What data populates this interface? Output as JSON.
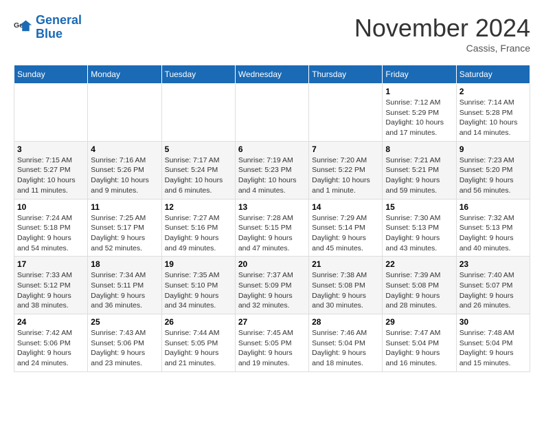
{
  "logo": {
    "text_general": "General",
    "text_blue": "Blue"
  },
  "header": {
    "month": "November 2024",
    "location": "Cassis, France"
  },
  "weekdays": [
    "Sunday",
    "Monday",
    "Tuesday",
    "Wednesday",
    "Thursday",
    "Friday",
    "Saturday"
  ],
  "weeks": [
    [
      {
        "day": "",
        "info": ""
      },
      {
        "day": "",
        "info": ""
      },
      {
        "day": "",
        "info": ""
      },
      {
        "day": "",
        "info": ""
      },
      {
        "day": "",
        "info": ""
      },
      {
        "day": "1",
        "info": "Sunrise: 7:12 AM\nSunset: 5:29 PM\nDaylight: 10 hours and 17 minutes."
      },
      {
        "day": "2",
        "info": "Sunrise: 7:14 AM\nSunset: 5:28 PM\nDaylight: 10 hours and 14 minutes."
      }
    ],
    [
      {
        "day": "3",
        "info": "Sunrise: 7:15 AM\nSunset: 5:27 PM\nDaylight: 10 hours and 11 minutes."
      },
      {
        "day": "4",
        "info": "Sunrise: 7:16 AM\nSunset: 5:26 PM\nDaylight: 10 hours and 9 minutes."
      },
      {
        "day": "5",
        "info": "Sunrise: 7:17 AM\nSunset: 5:24 PM\nDaylight: 10 hours and 6 minutes."
      },
      {
        "day": "6",
        "info": "Sunrise: 7:19 AM\nSunset: 5:23 PM\nDaylight: 10 hours and 4 minutes."
      },
      {
        "day": "7",
        "info": "Sunrise: 7:20 AM\nSunset: 5:22 PM\nDaylight: 10 hours and 1 minute."
      },
      {
        "day": "8",
        "info": "Sunrise: 7:21 AM\nSunset: 5:21 PM\nDaylight: 9 hours and 59 minutes."
      },
      {
        "day": "9",
        "info": "Sunrise: 7:23 AM\nSunset: 5:20 PM\nDaylight: 9 hours and 56 minutes."
      }
    ],
    [
      {
        "day": "10",
        "info": "Sunrise: 7:24 AM\nSunset: 5:18 PM\nDaylight: 9 hours and 54 minutes."
      },
      {
        "day": "11",
        "info": "Sunrise: 7:25 AM\nSunset: 5:17 PM\nDaylight: 9 hours and 52 minutes."
      },
      {
        "day": "12",
        "info": "Sunrise: 7:27 AM\nSunset: 5:16 PM\nDaylight: 9 hours and 49 minutes."
      },
      {
        "day": "13",
        "info": "Sunrise: 7:28 AM\nSunset: 5:15 PM\nDaylight: 9 hours and 47 minutes."
      },
      {
        "day": "14",
        "info": "Sunrise: 7:29 AM\nSunset: 5:14 PM\nDaylight: 9 hours and 45 minutes."
      },
      {
        "day": "15",
        "info": "Sunrise: 7:30 AM\nSunset: 5:13 PM\nDaylight: 9 hours and 43 minutes."
      },
      {
        "day": "16",
        "info": "Sunrise: 7:32 AM\nSunset: 5:13 PM\nDaylight: 9 hours and 40 minutes."
      }
    ],
    [
      {
        "day": "17",
        "info": "Sunrise: 7:33 AM\nSunset: 5:12 PM\nDaylight: 9 hours and 38 minutes."
      },
      {
        "day": "18",
        "info": "Sunrise: 7:34 AM\nSunset: 5:11 PM\nDaylight: 9 hours and 36 minutes."
      },
      {
        "day": "19",
        "info": "Sunrise: 7:35 AM\nSunset: 5:10 PM\nDaylight: 9 hours and 34 minutes."
      },
      {
        "day": "20",
        "info": "Sunrise: 7:37 AM\nSunset: 5:09 PM\nDaylight: 9 hours and 32 minutes."
      },
      {
        "day": "21",
        "info": "Sunrise: 7:38 AM\nSunset: 5:08 PM\nDaylight: 9 hours and 30 minutes."
      },
      {
        "day": "22",
        "info": "Sunrise: 7:39 AM\nSunset: 5:08 PM\nDaylight: 9 hours and 28 minutes."
      },
      {
        "day": "23",
        "info": "Sunrise: 7:40 AM\nSunset: 5:07 PM\nDaylight: 9 hours and 26 minutes."
      }
    ],
    [
      {
        "day": "24",
        "info": "Sunrise: 7:42 AM\nSunset: 5:06 PM\nDaylight: 9 hours and 24 minutes."
      },
      {
        "day": "25",
        "info": "Sunrise: 7:43 AM\nSunset: 5:06 PM\nDaylight: 9 hours and 23 minutes."
      },
      {
        "day": "26",
        "info": "Sunrise: 7:44 AM\nSunset: 5:05 PM\nDaylight: 9 hours and 21 minutes."
      },
      {
        "day": "27",
        "info": "Sunrise: 7:45 AM\nSunset: 5:05 PM\nDaylight: 9 hours and 19 minutes."
      },
      {
        "day": "28",
        "info": "Sunrise: 7:46 AM\nSunset: 5:04 PM\nDaylight: 9 hours and 18 minutes."
      },
      {
        "day": "29",
        "info": "Sunrise: 7:47 AM\nSunset: 5:04 PM\nDaylight: 9 hours and 16 minutes."
      },
      {
        "day": "30",
        "info": "Sunrise: 7:48 AM\nSunset: 5:04 PM\nDaylight: 9 hours and 15 minutes."
      }
    ]
  ]
}
